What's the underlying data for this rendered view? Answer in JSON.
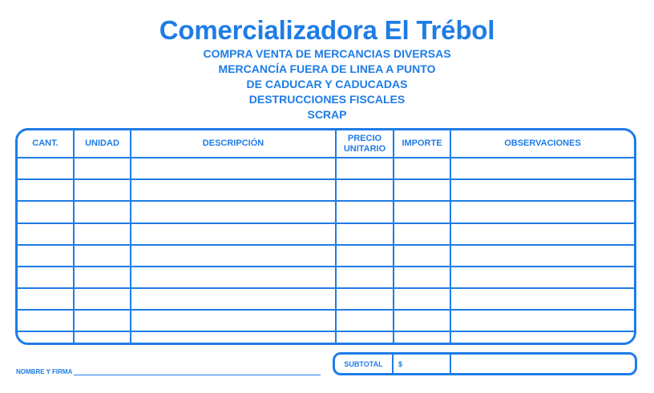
{
  "header": {
    "company": "Comercializadora El Trébol",
    "taglines": [
      "COMPRA VENTA DE MERCANCIAS DIVERSAS",
      "MERCANCÍA FUERA DE LINEA A PUNTO",
      "DE CADUCAR Y CADUCADAS",
      "DESTRUCCIONES FISCALES",
      "SCRAP"
    ]
  },
  "table": {
    "columns": [
      "CANT.",
      "UNIDAD",
      "DESCRIPCIÓN",
      "PRECIO\nUNITARIO",
      "IMPORTE",
      "OBSERVACIONES"
    ]
  },
  "footer": {
    "signature_label": "NOMBRE Y FIRMA",
    "subtotal_label": "SUBTOTAL",
    "currency_symbol": "$"
  },
  "colors": {
    "accent": "#1f7ce6"
  }
}
